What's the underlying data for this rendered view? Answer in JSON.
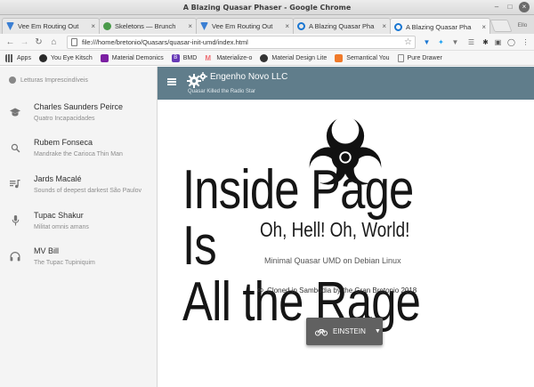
{
  "window": {
    "title": "A Blazing Quasar Phaser - Google Chrome"
  },
  "tabs": [
    {
      "label": "Vee Em Routing Out",
      "icon": "vee-favicon-icon",
      "color": "#3b7fd3"
    },
    {
      "label": "Skeletons — Brunch",
      "icon": "skeleton-favicon-icon",
      "color": "#4a9a4a"
    },
    {
      "label": "Vee Em Routing Out",
      "icon": "vee-favicon-icon",
      "color": "#3b7fd3"
    },
    {
      "label": "A Blazing Quasar Pha",
      "icon": "quasar-favicon-icon",
      "color": "#1976d2"
    },
    {
      "label": "A Blazing Quasar Pha",
      "icon": "quasar-favicon-icon",
      "color": "#1976d2"
    }
  ],
  "profile_label": "Ello",
  "address": {
    "url": "file:///home/bretonio/Quasars/quasar-init-umd/index.html"
  },
  "bookmarks": [
    {
      "label": "Apps",
      "icon": "apps-grid-icon",
      "color": "#5b5b5b"
    },
    {
      "label": "You Eye Kitsch",
      "icon": "uikit-icon",
      "color": "#2a2a2a"
    },
    {
      "label": "Material Demonics",
      "icon": "material-icon",
      "color": "#7b1fa2"
    },
    {
      "label": "BMD",
      "icon": "bmd-icon",
      "color": "#673ab7"
    },
    {
      "label": "Materialize-o",
      "icon": "materialize-icon",
      "color": "#ee6e73"
    },
    {
      "label": "Material Design Lite",
      "icon": "mdl-icon",
      "color": "#333333"
    },
    {
      "label": "Semantical You",
      "icon": "semantic-icon",
      "color": "#f07a2a"
    },
    {
      "label": "Pure Drawer",
      "icon": "page-icon",
      "color": "#888888"
    }
  ],
  "drawer": {
    "header": "Letturas Imprescindíveis",
    "items": [
      {
        "label": "Charles Saunders Peirce",
        "sub": "Quatro Incapacidades",
        "icon": "school-icon"
      },
      {
        "label": "Rubem Fonseca",
        "sub": "Mandrake the Carioca Thin Man",
        "icon": "search-icon"
      },
      {
        "label": "Jards Macalé",
        "sub": "Sounds of deepest darkest São Paulov",
        "icon": "queue-music-icon"
      },
      {
        "label": "Tupac Shakur",
        "sub": "Militat omnis amans",
        "icon": "microphone-icon"
      },
      {
        "label": "MV Bill",
        "sub": "The Tupac Tupiniquim",
        "icon": "headset-icon"
      }
    ]
  },
  "toolbar": {
    "title": "Engenho Novo LLC",
    "subtitle": "Quasar Killed the Radio Star"
  },
  "main": {
    "title_line1": "Inside Page Is",
    "title_line2": "All the Rage",
    "subtitle": "Oh, Hell! Oh, World!",
    "caption": "Minimal Quasar UMD on Debian Linux",
    "credit": "Cloned in Sambodia by the Gran Bretonio 2018",
    "button_label": "EINSTEIN"
  },
  "colors": {
    "toolbar": "#607d8b",
    "drawer": "#f4f4f4",
    "button": "#616161"
  }
}
